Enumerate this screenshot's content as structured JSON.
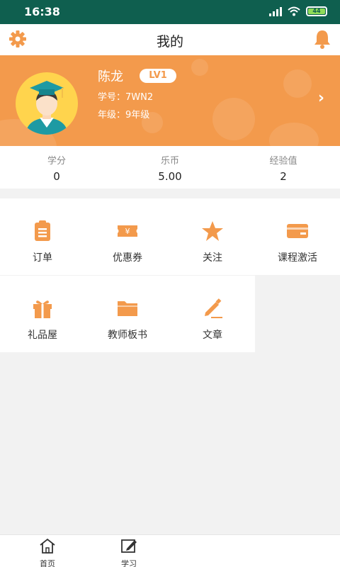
{
  "status_bar": {
    "time": "16:38",
    "battery": "44"
  },
  "header": {
    "title": "我的"
  },
  "profile": {
    "name": "陈龙",
    "level": "LV1",
    "student_id": "学号：7WN2",
    "grade": "年级：9年级"
  },
  "stats": [
    {
      "label": "学分",
      "value": "0"
    },
    {
      "label": "乐币",
      "value": "5.00"
    },
    {
      "label": "经验值",
      "value": "2"
    }
  ],
  "menu": [
    {
      "label": "订单",
      "icon": "clipboard-icon"
    },
    {
      "label": "优惠券",
      "icon": "coupon-icon"
    },
    {
      "label": "关注",
      "icon": "star-icon"
    },
    {
      "label": "课程激活",
      "icon": "card-icon"
    },
    {
      "label": "礼品屋",
      "icon": "gift-icon"
    },
    {
      "label": "教师板书",
      "icon": "folder-icon"
    },
    {
      "label": "文章",
      "icon": "pencil-icon"
    }
  ],
  "tabbar": [
    {
      "label": "首页",
      "icon": "home-icon"
    },
    {
      "label": "学习",
      "icon": "edit-icon"
    }
  ],
  "colors": {
    "accent": "#f39a4c",
    "status_bar": "#0f5f4f"
  }
}
